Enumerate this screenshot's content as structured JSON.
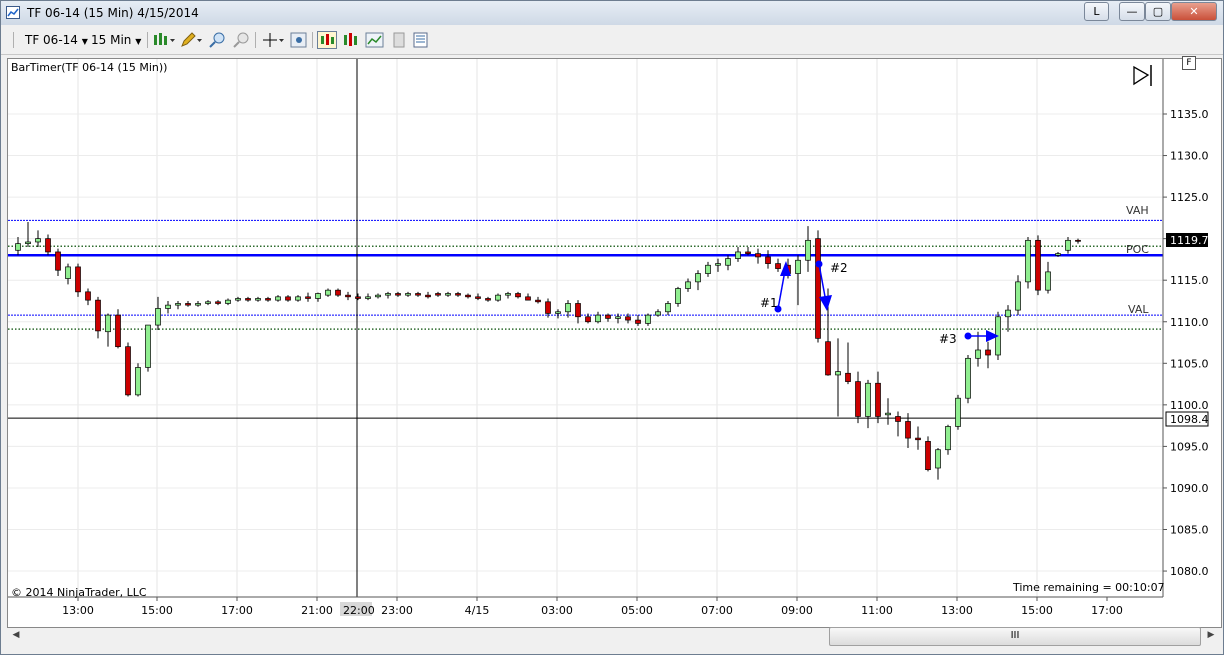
{
  "window": {
    "title": "TF 06-14 (15 Min)  4/15/2014",
    "link_button": "L",
    "minimize_label": "—",
    "maximize_label": "▢",
    "close_label": "✕"
  },
  "toolbar": {
    "instrument": "TF 06-14",
    "interval": "15 Min"
  },
  "chart": {
    "indicator_label": "BarTimer(TF 06-14 (15 Min))",
    "copyright": "© 2014 NinjaTrader, LLC",
    "time_remaining": "Time remaining = 00:10:07",
    "f_button": "F",
    "scroll_thumb": "III",
    "scroll_left": "◀",
    "scroll_right": "▶",
    "crosshair_time_label": "22:00",
    "current_price": "1119.7",
    "crosshair_price": "1098.4",
    "levels": {
      "vah": "VAH",
      "poc": "POC",
      "val": "VAL"
    },
    "annotations": [
      "#1",
      "#2",
      "#3"
    ],
    "colors": {
      "up": "#90ee90",
      "down": "#cc0000",
      "level_line": "#0000ff",
      "poc_dots": "#2e6b2e"
    }
  },
  "chart_data": {
    "type": "candlestick",
    "instrument": "TF 06-14",
    "interval": "15 Min",
    "y_ticks": [
      "1135.0",
      "1130.0",
      "1125.0",
      "1120.0",
      "1115.0",
      "1110.0",
      "1105.0",
      "1100.0",
      "1095.0",
      "1090.0",
      "1085.0",
      "1080.0"
    ],
    "y_range": [
      1079,
      1142
    ],
    "x_ticks": [
      "13:00",
      "15:00",
      "17:00",
      "21:00",
      "23:00",
      "4/15",
      "03:00",
      "05:00",
      "07:00",
      "09:00",
      "11:00",
      "13:00",
      "15:00",
      "17:00"
    ],
    "levels": [
      {
        "label": "VAH",
        "price": 1122.2
      },
      {
        "label": "POC",
        "price": 1118.0
      },
      {
        "label": "VAL",
        "price": 1110.8
      }
    ],
    "last_price": 1119.7,
    "crosshair_price": 1098.4,
    "crosshair_time": "22:00",
    "candles": [
      [
        1118.6,
        1120.2,
        1118.0,
        1119.4
      ],
      [
        1119.4,
        1122.0,
        1119.0,
        1119.6
      ],
      [
        1119.6,
        1121.0,
        1119.0,
        1120.0
      ],
      [
        1120.0,
        1120.5,
        1118.0,
        1118.4
      ],
      [
        1118.4,
        1118.8,
        1115.5,
        1116.2
      ],
      [
        1115.2,
        1117.0,
        1114.5,
        1116.6
      ],
      [
        1116.6,
        1117.0,
        1113.0,
        1113.6
      ],
      [
        1113.6,
        1114.0,
        1112.0,
        1112.6
      ],
      [
        1112.6,
        1113.0,
        1108.0,
        1108.9
      ],
      [
        1108.8,
        1111.0,
        1107.0,
        1110.8
      ],
      [
        1110.8,
        1111.5,
        1106.8,
        1107.0
      ],
      [
        1107.0,
        1107.5,
        1101.0,
        1101.2
      ],
      [
        1101.2,
        1105.0,
        1101.0,
        1104.5
      ],
      [
        1104.5,
        1109.5,
        1104.0,
        1109.6
      ],
      [
        1109.6,
        1113.0,
        1109.0,
        1111.6
      ],
      [
        1111.6,
        1112.5,
        1111.0,
        1112.0
      ],
      [
        1112.0,
        1112.5,
        1111.5,
        1112.2
      ],
      [
        1112.2,
        1112.5,
        1111.8,
        1112.0
      ],
      [
        1112.0,
        1112.5,
        1111.8,
        1112.2
      ],
      [
        1112.2,
        1112.6,
        1112.0,
        1112.4
      ],
      [
        1112.4,
        1112.6,
        1112.0,
        1112.2
      ],
      [
        1112.2,
        1112.8,
        1112.0,
        1112.6
      ],
      [
        1112.6,
        1113.0,
        1112.4,
        1112.8
      ],
      [
        1112.8,
        1113.0,
        1112.4,
        1112.6
      ],
      [
        1112.6,
        1113.0,
        1112.4,
        1112.8
      ],
      [
        1112.8,
        1113.0,
        1112.4,
        1112.6
      ],
      [
        1112.6,
        1113.2,
        1112.4,
        1113.0
      ],
      [
        1113.0,
        1113.2,
        1112.4,
        1112.6
      ],
      [
        1112.6,
        1113.2,
        1112.4,
        1113.0
      ],
      [
        1113.0,
        1113.5,
        1112.4,
        1112.8
      ],
      [
        1112.8,
        1113.5,
        1112.4,
        1113.4
      ],
      [
        1113.2,
        1114.0,
        1113.0,
        1113.8
      ],
      [
        1113.8,
        1114.0,
        1113.0,
        1113.2
      ],
      [
        1113.2,
        1113.6,
        1112.6,
        1113.0
      ],
      [
        1113.0,
        1113.4,
        1112.6,
        1112.8
      ],
      [
        1112.8,
        1113.4,
        1112.6,
        1113.0
      ],
      [
        1113.0,
        1113.4,
        1112.8,
        1113.2
      ],
      [
        1113.2,
        1113.6,
        1112.8,
        1113.4
      ],
      [
        1113.4,
        1113.6,
        1113.0,
        1113.2
      ],
      [
        1113.2,
        1113.6,
        1113.0,
        1113.4
      ],
      [
        1113.4,
        1113.6,
        1113.0,
        1113.2
      ],
      [
        1113.2,
        1113.6,
        1112.8,
        1113.0
      ],
      [
        1113.4,
        1113.6,
        1113.0,
        1113.2
      ],
      [
        1113.2,
        1113.6,
        1113.0,
        1113.4
      ],
      [
        1113.4,
        1113.6,
        1113.0,
        1113.2
      ],
      [
        1113.2,
        1113.4,
        1112.8,
        1113.0
      ],
      [
        1113.0,
        1113.4,
        1112.6,
        1112.8
      ],
      [
        1112.8,
        1113.0,
        1112.4,
        1112.6
      ],
      [
        1112.6,
        1113.4,
        1112.4,
        1113.2
      ],
      [
        1113.2,
        1113.6,
        1112.8,
        1113.4
      ],
      [
        1113.4,
        1113.6,
        1112.8,
        1113.0
      ],
      [
        1113.0,
        1113.4,
        1112.6,
        1112.6
      ],
      [
        1112.6,
        1113.0,
        1112.2,
        1112.4
      ],
      [
        1112.4,
        1112.8,
        1110.5,
        1111.0
      ],
      [
        1111.0,
        1111.5,
        1110.4,
        1111.2
      ],
      [
        1111.2,
        1112.6,
        1110.5,
        1112.2
      ],
      [
        1112.2,
        1112.6,
        1109.8,
        1110.6
      ],
      [
        1110.6,
        1111.0,
        1109.8,
        1110.0
      ],
      [
        1110.0,
        1111.2,
        1109.8,
        1110.8
      ],
      [
        1110.8,
        1111.0,
        1110.0,
        1110.4
      ],
      [
        1110.4,
        1111.0,
        1109.8,
        1110.6
      ],
      [
        1110.6,
        1111.0,
        1109.8,
        1110.2
      ],
      [
        1110.2,
        1110.8,
        1109.5,
        1109.8
      ],
      [
        1109.8,
        1111.0,
        1109.5,
        1110.8
      ],
      [
        1110.8,
        1111.5,
        1110.6,
        1111.2
      ],
      [
        1111.2,
        1112.5,
        1110.8,
        1112.2
      ],
      [
        1112.2,
        1114.2,
        1111.8,
        1114.0
      ],
      [
        1114.0,
        1115.2,
        1113.6,
        1114.8
      ],
      [
        1114.8,
        1116.2,
        1113.8,
        1115.8
      ],
      [
        1115.8,
        1117.2,
        1115.4,
        1116.8
      ],
      [
        1116.8,
        1117.6,
        1116.0,
        1117.0
      ],
      [
        1116.8,
        1118.0,
        1116.2,
        1117.6
      ],
      [
        1117.6,
        1119.0,
        1117.2,
        1118.4
      ],
      [
        1118.4,
        1119.0,
        1118.0,
        1118.2
      ],
      [
        1118.2,
        1118.8,
        1117.0,
        1117.8
      ],
      [
        1117.8,
        1118.6,
        1116.4,
        1117.0
      ],
      [
        1117.0,
        1117.6,
        1116.0,
        1116.4
      ],
      [
        1116.8,
        1117.6,
        1115.2,
        1115.8
      ],
      [
        1115.8,
        1118.0,
        1112.0,
        1117.4
      ],
      [
        1117.4,
        1121.5,
        1116.0,
        1119.8
      ],
      [
        1120.0,
        1121.0,
        1107.5,
        1108.0
      ],
      [
        1107.6,
        1114.0,
        1103.5,
        1103.6
      ],
      [
        1103.6,
        1108.0,
        1098.6,
        1104.0
      ],
      [
        1103.8,
        1107.5,
        1102.5,
        1102.8
      ],
      [
        1102.8,
        1104.0,
        1097.8,
        1098.6
      ],
      [
        1098.6,
        1103.0,
        1097.2,
        1102.6
      ],
      [
        1102.6,
        1104.0,
        1097.8,
        1098.6
      ],
      [
        1098.8,
        1100.8,
        1097.6,
        1099.0
      ],
      [
        1098.6,
        1099.2,
        1096.2,
        1098.0
      ],
      [
        1098.0,
        1099.0,
        1094.8,
        1096.0
      ],
      [
        1096.0,
        1097.4,
        1094.6,
        1095.8
      ],
      [
        1095.6,
        1096.2,
        1092.0,
        1092.2
      ],
      [
        1092.4,
        1094.8,
        1091.0,
        1094.6
      ],
      [
        1094.6,
        1097.6,
        1094.0,
        1097.4
      ],
      [
        1097.4,
        1101.2,
        1097.0,
        1100.8
      ],
      [
        1100.8,
        1106.0,
        1100.2,
        1105.6
      ],
      [
        1105.6,
        1108.8,
        1104.6,
        1106.6
      ],
      [
        1106.6,
        1107.6,
        1104.4,
        1106.0
      ],
      [
        1106.0,
        1111.2,
        1105.4,
        1110.6
      ],
      [
        1110.6,
        1112.0,
        1108.8,
        1111.4
      ],
      [
        1111.4,
        1115.6,
        1110.8,
        1114.8
      ],
      [
        1114.8,
        1120.2,
        1114.0,
        1119.8
      ],
      [
        1119.8,
        1120.4,
        1113.2,
        1113.8
      ],
      [
        1113.8,
        1117.2,
        1113.4,
        1116.0
      ],
      [
        1118.0,
        1118.4,
        1117.8,
        1118.2
      ],
      [
        1118.6,
        1120.2,
        1118.2,
        1119.8
      ],
      [
        1119.8,
        1120.0,
        1119.4,
        1119.7
      ]
    ]
  }
}
